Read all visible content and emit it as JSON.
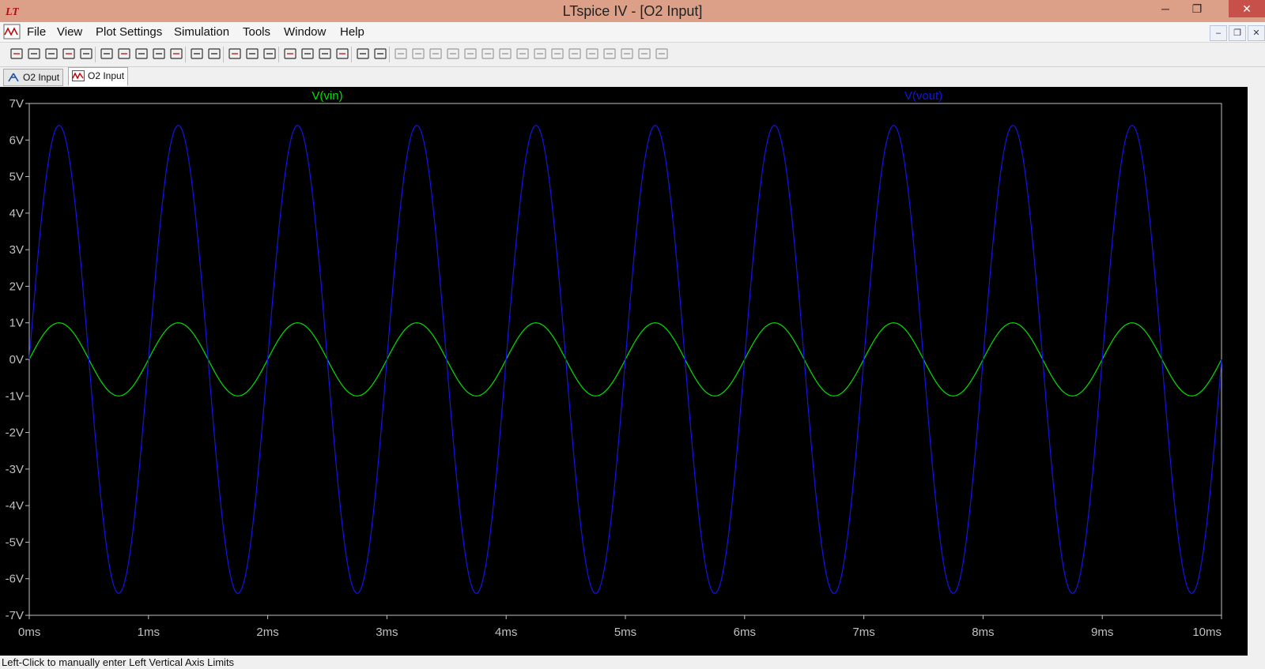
{
  "window": {
    "title": "LTspice IV - [O2 Input]",
    "controls": {
      "minimize": "─",
      "restore": "❐",
      "close": "✕"
    }
  },
  "menu": {
    "items": [
      "File",
      "View",
      "Plot Settings",
      "Simulation",
      "Tools",
      "Window",
      "Help"
    ],
    "mdi_controls": {
      "minimize": "–",
      "restore": "❐",
      "close": "✕"
    }
  },
  "toolbar": {
    "icons": [
      "new-schematic-icon",
      "open-icon",
      "save-icon",
      "control-panel-icon",
      "run-icon",
      "pan-icon",
      "zoom-area-icon",
      "zoom-in-icon",
      "zoom-out-icon",
      "zoom-cancel-icon",
      "autorange-icon",
      "pick-traces-icon",
      "tile-horizontal-icon",
      "cascade-icon",
      "tile-vertical-icon",
      "cut-icon",
      "copy-icon",
      "paste-icon",
      "find-icon",
      "print-preview-icon",
      "print-icon",
      "wire-icon",
      "ground-icon",
      "label-icon",
      "resistor-icon",
      "capacitor-icon",
      "inductor-icon",
      "diode-icon",
      "component-icon",
      "move-icon",
      "drag-icon",
      "undo-icon",
      "redo-icon",
      "rotate-icon",
      "mirror-icon",
      "text-icon",
      "spice-directive-icon"
    ]
  },
  "tabs": [
    {
      "label": "O2 Input",
      "kind": "schematic"
    },
    {
      "label": "O2 Input",
      "kind": "waveform",
      "active": true
    }
  ],
  "status": {
    "text": "Left-Click to manually enter Left Vertical Axis Limits"
  },
  "colors": {
    "vin": "#00e000",
    "vout": "#1414e6",
    "plot_bg": "#000000",
    "axis": "#c0c0c0"
  },
  "chart_data": {
    "type": "line",
    "title": "",
    "xlabel": "",
    "ylabel": "",
    "xlim": [
      0,
      10
    ],
    "ylim": [
      -7,
      7
    ],
    "x_ticks": [
      "0ms",
      "1ms",
      "2ms",
      "3ms",
      "4ms",
      "5ms",
      "6ms",
      "7ms",
      "8ms",
      "9ms",
      "10ms"
    ],
    "y_ticks": [
      "7V",
      "6V",
      "5V",
      "4V",
      "3V",
      "2V",
      "1V",
      "0V",
      "-1V",
      "-2V",
      "-3V",
      "-4V",
      "-5V",
      "-6V",
      "-7V"
    ],
    "grid": false,
    "series": [
      {
        "name": "V(vin)",
        "color": "#00e000",
        "waveform": "sine",
        "amplitude": 1.0,
        "frequency_khz": 1.0,
        "offset": 0,
        "unit": "V"
      },
      {
        "name": "V(vout)",
        "color": "#1414e6",
        "waveform": "sine",
        "amplitude": 6.4,
        "frequency_khz": 1.0,
        "offset": 0,
        "unit": "V"
      }
    ]
  }
}
